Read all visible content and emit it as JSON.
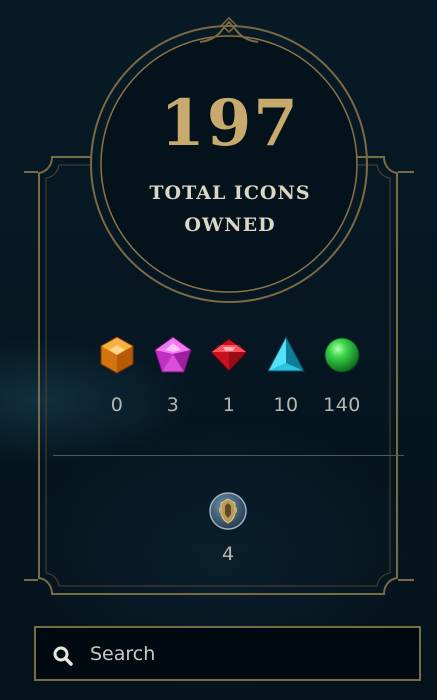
{
  "summary": {
    "total_count": "197",
    "total_label_line1": "TOTAL ICONS",
    "total_label_line2": "OWNED"
  },
  "rarity_tiers": [
    {
      "icon": "orange-gem-icon",
      "count": "0",
      "color": "#e88a1a"
    },
    {
      "icon": "pink-gem-icon",
      "count": "3",
      "color": "#d63fd6"
    },
    {
      "icon": "red-gem-icon",
      "count": "1",
      "color": "#e1232f"
    },
    {
      "icon": "blue-triangle-gem-icon",
      "count": "10",
      "color": "#2ec7e4"
    },
    {
      "icon": "green-orb-icon",
      "count": "140",
      "color": "#2fbf3a"
    }
  ],
  "special": {
    "icon": "crest-badge-icon",
    "count": "4"
  },
  "search": {
    "placeholder": "Search",
    "value": ""
  },
  "colors": {
    "gold": "#c8aa6e",
    "frame_gold": "#7b6a43",
    "background": "#061723",
    "text_light": "#b7b7ad"
  }
}
